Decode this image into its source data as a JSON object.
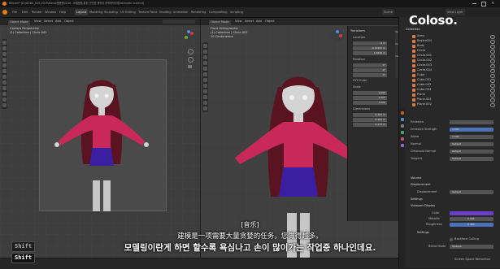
{
  "window": {
    "title": "Blender* [D:\\#0#0_SOS-2025\\Blend\\폴폴폴0249 - 모델링을 통한 간단한 캐릭터 캐릭캐릭모델3d\\model-1r.blend]"
  },
  "menu": {
    "items": [
      "File",
      "Edit",
      "Render",
      "Window",
      "Help"
    ],
    "workspaces": [
      "Layout",
      "Modeling",
      "Sculpting",
      "UV Editing",
      "Texture Paint",
      "Shading",
      "Animation",
      "Rendering",
      "Compositing",
      "Scripting"
    ],
    "active_workspace": "Layout",
    "scene_label": "Scene",
    "view_layer_label": "View Layer"
  },
  "left_viewport": {
    "mode": "Object Mode",
    "menus": [
      "View",
      "Select",
      "Add",
      "Object"
    ],
    "camera_label": "Camera Perspective",
    "collection_label": "(1) Collection | Circle.002"
  },
  "right_viewport": {
    "mode": "Object Mode",
    "menus": [
      "View",
      "Select",
      "Add",
      "Object"
    ],
    "view_label": "Front Orthographic",
    "collection_label": "(1) Collection | Circle.002",
    "units_label": "10 Centimeters"
  },
  "n_panel": {
    "header": "Transform",
    "location_label": "Location",
    "location": [
      "0 m",
      "-0.14193 m",
      "1.5046 m"
    ],
    "rotation_label": "Rotation",
    "rotation": [
      "0°",
      "0°",
      "0°"
    ],
    "rotation_mode": "XYZ Euler",
    "scale_label": "Scale",
    "scale": [
      "1.000",
      "1.000",
      "1.000"
    ],
    "dimensions_label": "Dimensions",
    "dimensions": [
      "0.163 m",
      "0.163 m",
      "0.173 m"
    ],
    "tabs": [
      "Item",
      "Tool",
      "View"
    ]
  },
  "outliner": {
    "header": "Collection",
    "rows": [
      {
        "name": "Arms",
        "color": "#e07a3a"
      },
      {
        "name": "Bezier001",
        "color": "#e07a3a"
      },
      {
        "name": "Body",
        "color": "#e07a3a"
      },
      {
        "name": "Circle",
        "color": "#e07a3a"
      },
      {
        "name": "Circle.001",
        "color": "#e07a3a"
      },
      {
        "name": "Circle.002",
        "color": "#e07a3a"
      },
      {
        "name": "Circle.003",
        "color": "#e07a3a"
      },
      {
        "name": "Circle.004",
        "color": "#e07a3a"
      },
      {
        "name": "Cube",
        "color": "#e07a3a"
      },
      {
        "name": "Cube.001",
        "color": "#e07a3a"
      },
      {
        "name": "Cube.002",
        "color": "#e07a3a"
      },
      {
        "name": "Cube.003",
        "color": "#e07a3a"
      },
      {
        "name": "Plane",
        "color": "#e07a3a"
      },
      {
        "name": "Plane.001",
        "color": "#e07a3a"
      },
      {
        "name": "Plane.002",
        "color": "#e07a3a"
      }
    ]
  },
  "properties": {
    "rows": [
      {
        "label": "Emission",
        "value": ""
      },
      {
        "label": "Emission Strength",
        "value": "1.000"
      },
      {
        "label": "Alpha",
        "value": "1.000"
      },
      {
        "label": "Normal",
        "value": "Default"
      },
      {
        "label": "Clearcoat Normal",
        "value": "Default"
      },
      {
        "label": "Tangent",
        "value": "Default"
      }
    ],
    "sections": [
      "Volume",
      "Displacement"
    ],
    "displacement_label": "Displacement",
    "displacement_value": "Default",
    "settings_label": "Settings",
    "viewport_display_label": "Viewport Display",
    "vd_rows": [
      {
        "label": "Color",
        "color": "#6a3fc8"
      },
      {
        "label": "Metallic",
        "value": "0.000"
      },
      {
        "label": "Roughness",
        "value": "0.400"
      }
    ],
    "settings2_label": "Settings",
    "backface_label": "Backface Culling",
    "blend_mode_label": "Blend Mode",
    "blend_mode_value": "Opaque",
    "shadow_label": "Screen Space Refraction"
  },
  "subtitles": {
    "tag": "[音乐]",
    "chinese": "建模是一项需要大量贪婪的任务，您做得越多。",
    "korean": "모델링이란게 하면 할수록 욕심나고 손이 많이가는 작업중 하나인데요."
  },
  "keys": [
    "Shift",
    "Shift"
  ],
  "logo": "Coloso.",
  "colors": {
    "shirt": "#c8295a",
    "skirt": "#3a1fa0",
    "hair": "#5a1320",
    "skin": "#d0d0d0",
    "legs": "#c6c6c6"
  }
}
